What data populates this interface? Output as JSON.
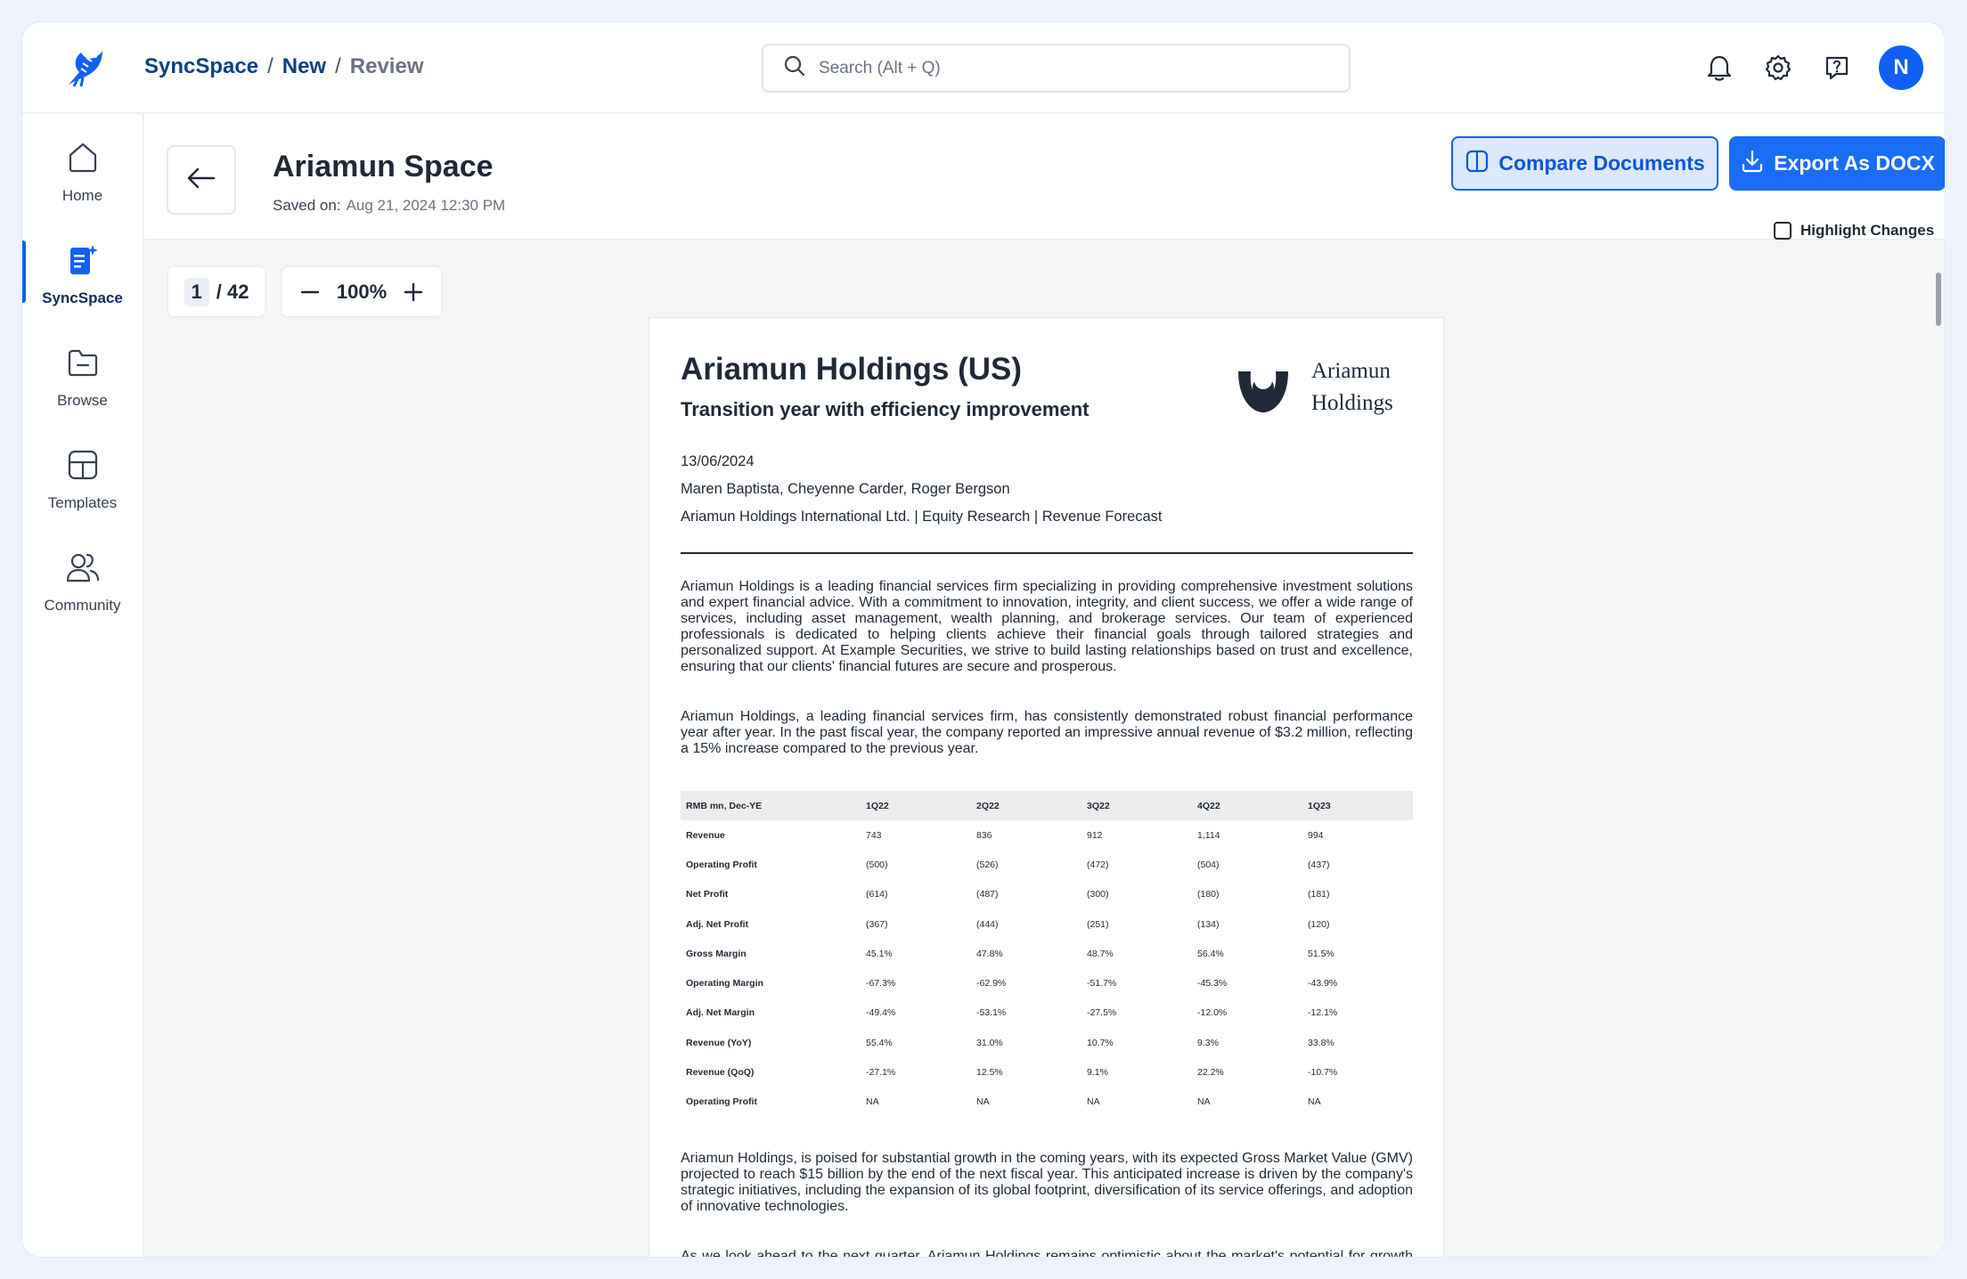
{
  "topbar": {
    "breadcrumb": [
      "SyncSpace",
      "New",
      "Review"
    ],
    "search_placeholder": "Search (Alt + Q)",
    "avatar_initial": "N"
  },
  "sidebar": {
    "items": [
      {
        "label": "Home",
        "icon": "home-icon"
      },
      {
        "label": "SyncSpace",
        "icon": "syncspace-doc-icon",
        "active": true
      },
      {
        "label": "Browse",
        "icon": "folder-icon"
      },
      {
        "label": "Templates",
        "icon": "templates-icon"
      },
      {
        "label": "Community",
        "icon": "community-icon"
      }
    ]
  },
  "header": {
    "title": "Ariamun Space",
    "saved_label": "Saved on:",
    "saved_value": "Aug 21, 2024 12:30 PM",
    "compare_label": "Compare Documents",
    "export_label": "Export As DOCX",
    "highlight_label": "Highlight Changes",
    "highlight_checked": false
  },
  "viewer": {
    "current_page": "1",
    "total_pages": "/ 42",
    "zoom": "100%"
  },
  "document": {
    "title": "Ariamun Holdings (US)",
    "subtitle": "Transition year with efficiency improvement",
    "logo_line1": "Ariamun",
    "logo_line2": "Holdings",
    "date": "13/06/2024",
    "authors": "Maren Baptista, Cheyenne Carder, Roger Bergson",
    "org": "Ariamun Holdings International Ltd.  | Equity Research | Revenue Forecast",
    "para1": "Ariamun Holdings is a leading financial services firm specializing in providing comprehensive investment solutions and expert financial advice. With a commitment to innovation, integrity, and client success, we offer a wide range of services, including asset management, wealth planning, and brokerage services. Our team of experienced professionals is dedicated to helping clients achieve their financial goals through tailored strategies and personalized support. At Example Securities, we strive to build lasting relationships based on trust and excellence, ensuring that our clients' financial futures are secure and prosperous.",
    "para2": "Ariamun Holdings, a leading financial services firm, has consistently demonstrated robust financial performance year after year. In the past fiscal year, the company reported an impressive annual revenue of $3.2 million, reflecting a 15% increase compared to the previous year.",
    "table": {
      "headers": [
        "RMB mn, Dec-YE",
        "1Q22",
        "2Q22",
        "3Q22",
        "4Q22",
        "1Q23"
      ],
      "rows": [
        [
          "Revenue",
          "743",
          "836",
          "912",
          "1,114",
          "994"
        ],
        [
          "Operating Profit",
          "(500)",
          "(526)",
          "(472)",
          "(504)",
          "(437)"
        ],
        [
          "Net Profit",
          "(614)",
          "(487)",
          "(300)",
          "(180)",
          "(181)"
        ],
        [
          "Adj. Net Profit",
          "(367)",
          "(444)",
          "(251)",
          "(134)",
          "(120)"
        ],
        [
          "Gross Margin",
          "45.1%",
          "47.8%",
          "48.7%",
          "56.4%",
          "51.5%"
        ],
        [
          "Operating Margin",
          "-67.3%",
          "-62.9%",
          "-51.7%",
          "-45.3%",
          "-43.9%"
        ],
        [
          "Adj. Net Margin",
          "-49.4%",
          "-53.1%",
          "-27.5%",
          "-12.0%",
          "-12.1%"
        ],
        [
          "Revenue (YoY)",
          "55.4%",
          "31.0%",
          "10.7%",
          "9.3%",
          "33.8%"
        ],
        [
          "Revenue (QoQ)",
          "-27.1%",
          "12.5%",
          "9.1%",
          "22.2%",
          "-10.7%"
        ],
        [
          "Operating Profit",
          "NA",
          "NA",
          "NA",
          "NA",
          "NA"
        ]
      ]
    },
    "para3": "Ariamun Holdings, is poised for substantial growth in the coming years, with its expected Gross Market Value (GMV) projected to reach $15 billion by the end of the next fiscal year. This anticipated increase is driven by the company's strategic initiatives, including the expansion of its global footprint, diversification of its service offerings, and adoption of innovative technologies.",
    "para4": "As we look ahead to the next quarter, Ariamun Holdings remains optimistic about the market's potential for growth and resilience. Despite ongoing economic challenges, our analysis indicates several key opportunities for strategic investments and portfolio diversification. We anticipate moderate gains in the technology and healthcare sectors, driven by innovation and increased demand."
  },
  "colors": {
    "accent": "#1160f5",
    "breadcrumb_link": "#0f3f86",
    "compare_bg": "#dce9fd"
  }
}
